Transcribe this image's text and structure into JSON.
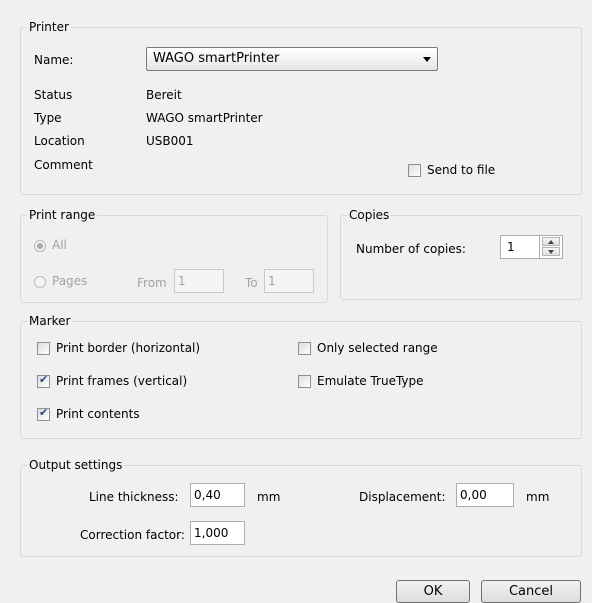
{
  "printer": {
    "legend": "Printer",
    "name_label": "Name:",
    "name_value": "WAGO smartPrinter",
    "status_label": "Status",
    "status_value": "Bereit",
    "type_label": "Type",
    "type_value": "WAGO smartPrinter",
    "location_label": "Location",
    "location_value": "USB001",
    "comment_label": "Comment",
    "send_to_file": {
      "label": "Send to file",
      "checked": false
    }
  },
  "print_range": {
    "legend": "Print range",
    "all_label": "All",
    "all_selected": true,
    "pages_label": "Pages",
    "pages_selected": false,
    "from_label": "From",
    "from_value": "1",
    "to_label": "To",
    "to_value": "1"
  },
  "copies": {
    "legend": "Copies",
    "number_label": "Number of copies:",
    "number_value": "1"
  },
  "marker": {
    "legend": "Marker",
    "print_border": {
      "label": "Print border (horizontal)",
      "checked": false
    },
    "print_frames": {
      "label": "Print frames (vertical)",
      "checked": true
    },
    "print_contents": {
      "label": "Print contents",
      "checked": true
    },
    "only_selected": {
      "label": "Only selected range",
      "checked": false
    },
    "emulate_truetype": {
      "label": "Emulate TrueType",
      "checked": false
    }
  },
  "output": {
    "legend": "Output settings",
    "line_thickness_label": "Line thickness:",
    "line_thickness_value": "0,40",
    "line_thickness_unit": "mm",
    "displacement_label": "Displacement:",
    "displacement_value": "0,00",
    "displacement_unit": "mm",
    "correction_label": "Correction factor:",
    "correction_value": "1,000"
  },
  "buttons": {
    "ok": "OK",
    "cancel": "Cancel"
  }
}
